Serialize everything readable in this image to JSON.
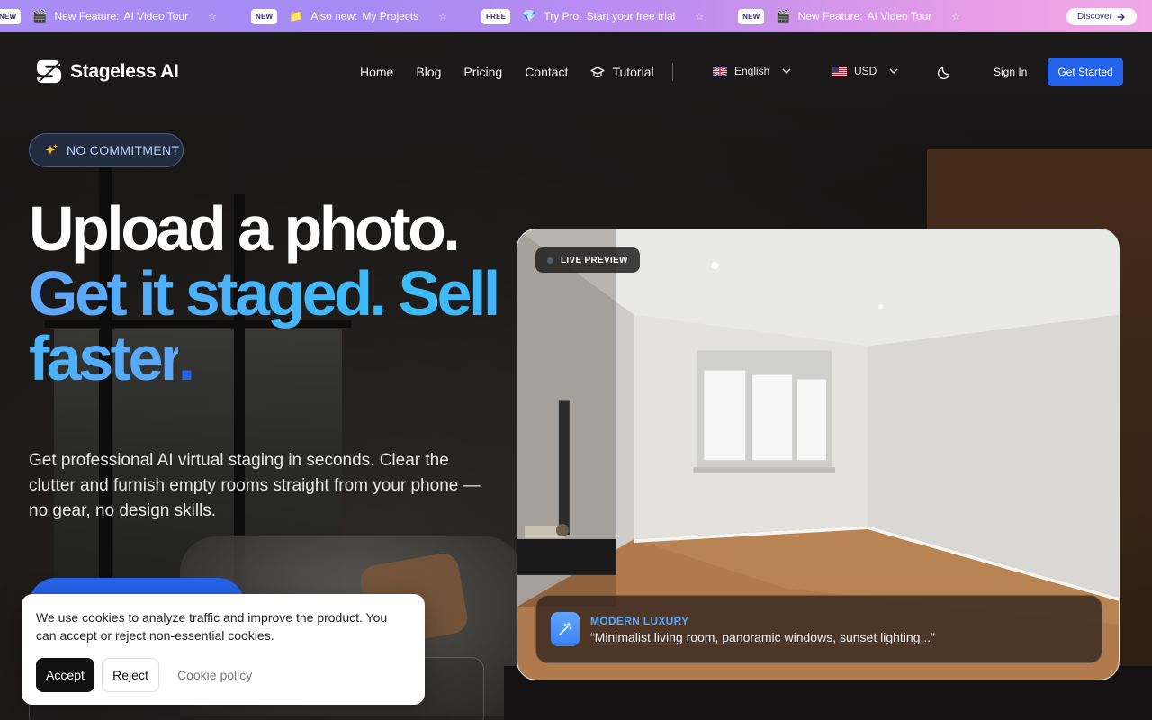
{
  "announcement_bar": {
    "items": [
      {
        "badge": "NEW",
        "emoji": "🎬",
        "label": "New Feature:",
        "text": "AI Video Tour"
      },
      {
        "badge": "NEW",
        "emoji": "📁",
        "label": "Also new:",
        "text": "My Projects"
      },
      {
        "badge": "FREE",
        "emoji": "💎",
        "label": "Try Pro:",
        "text": "Start your free trial"
      },
      {
        "badge": "NEW",
        "emoji": "🎬",
        "label": "New Feature:",
        "text": "AI Video Tour"
      }
    ],
    "separator_icon": "☆",
    "discover_label": "Discover"
  },
  "header": {
    "brand": "Stageless AI",
    "nav": [
      "Home",
      "Blog",
      "Pricing",
      "Contact"
    ],
    "tutorial_label": "Tutorial",
    "language": "English",
    "currency": "USD",
    "sign_in": "Sign In",
    "get_started": "Get Started"
  },
  "hero": {
    "badge": "NO COMMITMENT",
    "headline_line1": "Upload a photo.",
    "headline_line2": "Get it staged. Sell faster",
    "headline_dot": ".",
    "lead": "Get professional AI virtual staging in seconds. Clear the clutter and furnish empty rooms straight from your phone — no gear, no design skills."
  },
  "preview": {
    "live_label": "LIVE PREVIEW",
    "style_label": "MODERN LUXURY",
    "prompt_text": "“Minimalist living room, panoramic windows, sunset lighting...”"
  },
  "cookie_banner": {
    "message": "We use cookies to analyze traffic and improve the product. You can accept or reject non-essential cookies.",
    "accept": "Accept",
    "reject": "Reject",
    "policy_link": "Cookie policy"
  },
  "colors": {
    "accent": "#2563eb",
    "headline_gradient_start": "#60a5fa",
    "headline_gradient_end": "#38bdf8",
    "badge_text": "#b9d2ff"
  }
}
